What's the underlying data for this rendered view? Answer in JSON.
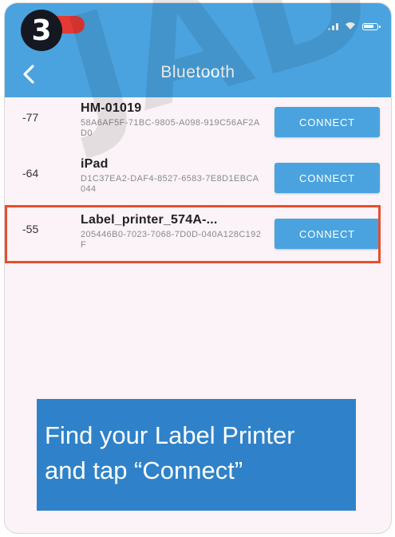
{
  "overlay": {
    "step_number": "3",
    "watermark": "JAD"
  },
  "header": {
    "title": "Bluetooth",
    "back_icon": "chevron-left-icon"
  },
  "status_bar": {
    "icons": [
      "signal-icon",
      "wifi-icon",
      "battery-icon"
    ]
  },
  "devices": [
    {
      "rssi": "-77",
      "name": "HM-01019",
      "id": "58A6AF5F-71BC-9805-A098-919C56AF2AD0",
      "button": "CONNECT"
    },
    {
      "rssi": "-64",
      "name": "iPad",
      "id": "D1C37EA2-DAF4-8527-6583-7E8D1EBCA044",
      "button": "CONNECT"
    },
    {
      "rssi": "-55",
      "name": "Label_printer_574A-...",
      "id": "205446B0-7023-7068-7D0D-040A128C192F",
      "button": "CONNECT"
    }
  ],
  "instruction": {
    "line1": "Find your Label Printer",
    "line2": "and tap “Connect”"
  },
  "colors": {
    "header": "#4aa3df",
    "button": "#4aa3df",
    "highlight": "#e84e2d",
    "instruction_bg": "#2f82c9"
  }
}
